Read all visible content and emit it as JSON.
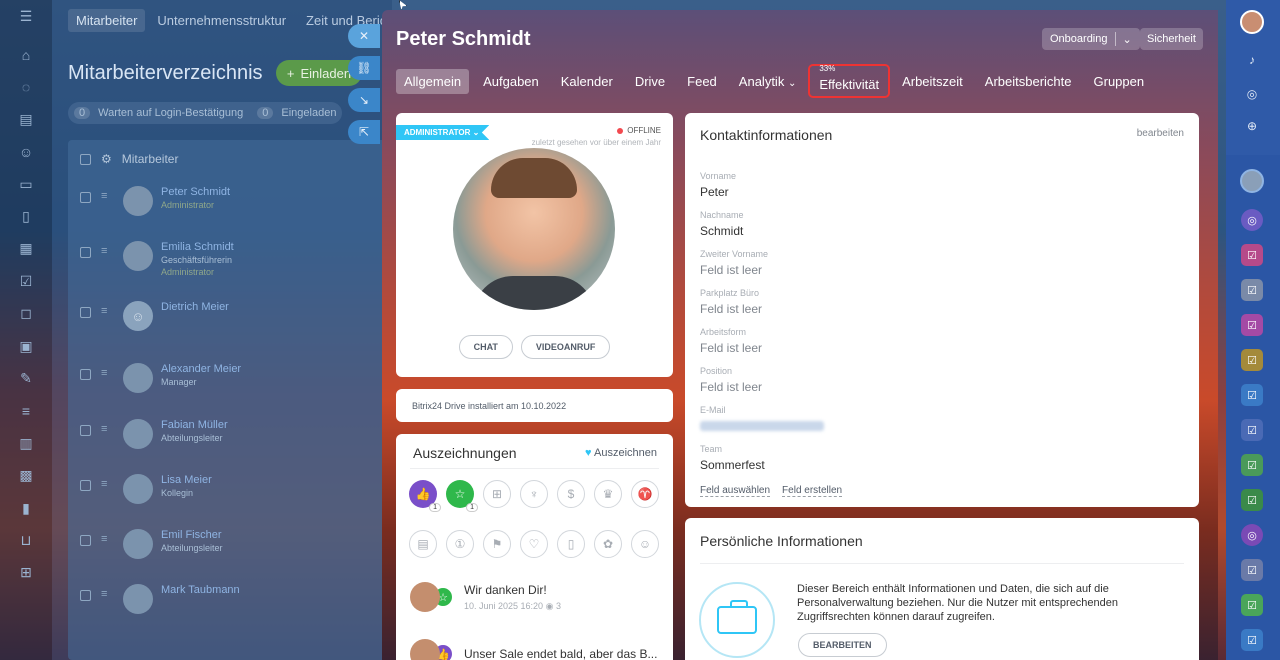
{
  "background_app": {
    "tabs": [
      "Mitarbeiter",
      "Unternehmensstruktur",
      "Zeit und Berichte"
    ],
    "title": "Mitarbeiterverzeichnis",
    "invite_label": "Einladen",
    "filters": [
      {
        "count": "0",
        "label": "Warten auf Login-Bestätigung"
      },
      {
        "count": "0",
        "label": "Eingeladen"
      }
    ],
    "table_header": "Mitarbeiter",
    "rows": [
      {
        "name": "Peter Schmidt",
        "role": "Administrator",
        "role2": ""
      },
      {
        "name": "Emilia Schmidt",
        "role": "Geschäftsführerin",
        "role2": "Administrator"
      },
      {
        "name": "Dietrich Meier",
        "role": "",
        "role2": ""
      },
      {
        "name": "Alexander Meier",
        "role": "Manager",
        "role2": ""
      },
      {
        "name": "Fabian Müller",
        "role": "Abteilungsleiter",
        "role2": ""
      },
      {
        "name": "Lisa Meier",
        "role": "Kollegin",
        "role2": ""
      },
      {
        "name": "Emil Fischer",
        "role": "Abteilungsleiter",
        "role2": ""
      },
      {
        "name": "Mark Taubmann",
        "role": "",
        "role2": ""
      }
    ]
  },
  "slider": {
    "title": "Peter Schmidt",
    "onboarding_label": "Onboarding",
    "security_label": "Sicherheit",
    "tabs": [
      "Allgemein",
      "Aufgaben",
      "Kalender",
      "Drive",
      "Feed",
      "Analytik",
      "Effektivität",
      "Arbeitszeit",
      "Arbeitsberichte",
      "Gruppen"
    ],
    "efficiency_pct": "33%"
  },
  "profile": {
    "role_badge": "ADMINISTRATOR",
    "status": "OFFLINE",
    "last_seen": "zuletzt gesehen vor über einem Jahr",
    "chat_label": "CHAT",
    "video_label": "VIDEOANRUF"
  },
  "drive_note": "Bitrix24 Drive installiert am 10.10.2022",
  "awards": {
    "title": "Auszeichnungen",
    "link": "Auszeichnen",
    "badge_counts": [
      "1",
      "1"
    ],
    "posts": [
      {
        "text": "Wir danken Dir!",
        "meta": "10. Juni 2025 16:20",
        "views": "3"
      },
      {
        "text": "Unser Sale endet bald, aber das B...",
        "meta": "",
        "views": ""
      }
    ]
  },
  "contact": {
    "title": "Kontaktinformationen",
    "edit": "bearbeiten",
    "fields": [
      {
        "label": "Vorname",
        "value": "Peter"
      },
      {
        "label": "Nachname",
        "value": "Schmidt"
      },
      {
        "label": "Zweiter Vorname",
        "value": "Feld ist leer"
      },
      {
        "label": "Parkplatz Büro",
        "value": "Feld ist leer"
      },
      {
        "label": "Arbeitsform",
        "value": "Feld ist leer"
      },
      {
        "label": "Position",
        "value": "Feld ist leer"
      },
      {
        "label": "E-Mail",
        "value": ""
      },
      {
        "label": "Team",
        "value": "Sommerfest"
      }
    ],
    "select_field": "Feld auswählen",
    "create_field": "Feld erstellen"
  },
  "personal": {
    "title": "Persönliche Informationen",
    "text": "Dieser Bereich enthält Informationen und Daten, die sich auf die Personalverwaltung beziehen. Nur die Nutzer mit entsprechenden Zugriffsrechten können darauf zugreifen.",
    "edit_label": "BEARBEITEN"
  }
}
